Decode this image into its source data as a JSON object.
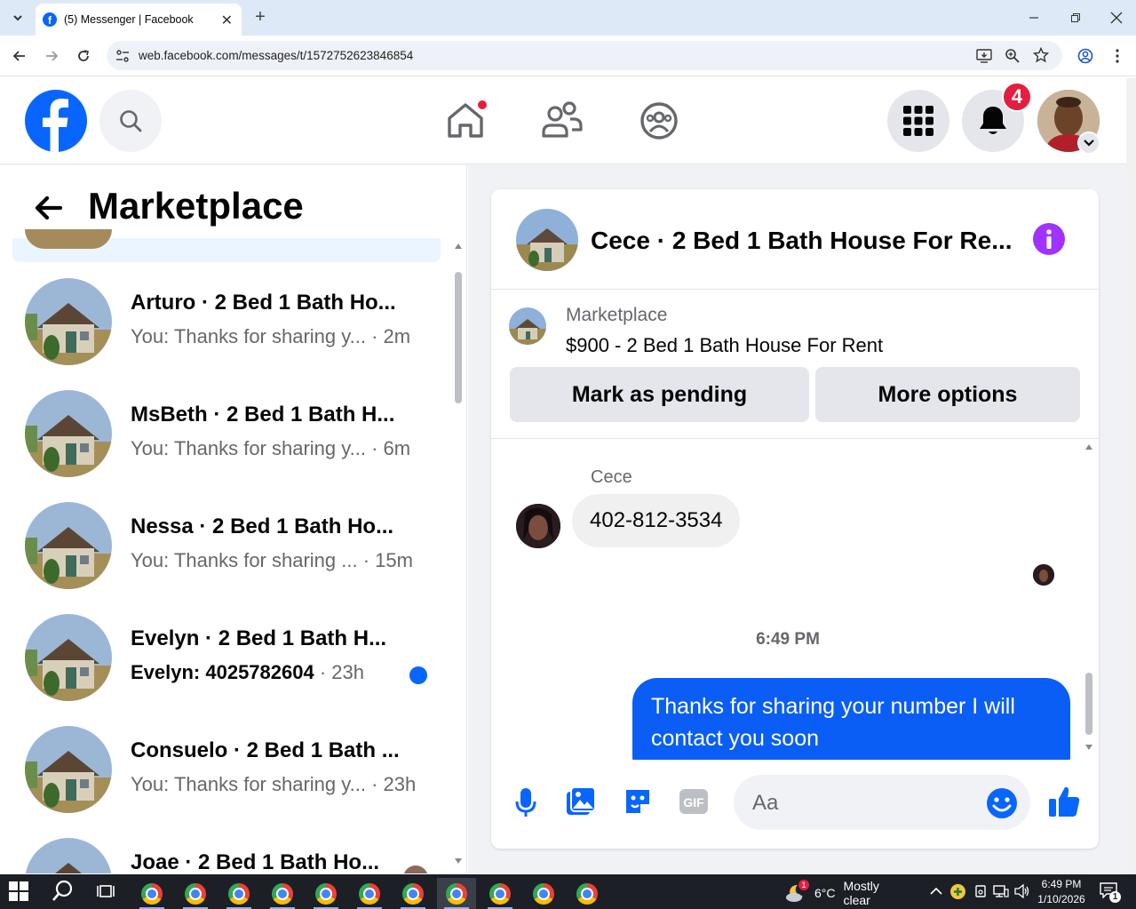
{
  "browser": {
    "tab_title": "(5) Messenger | Facebook",
    "url": "web.facebook.com/messages/t/1572752623846854"
  },
  "header": {
    "notification_count": "4"
  },
  "left_panel": {
    "title": "Marketplace",
    "conversations": [
      {
        "name": "Arturo · 2 Bed 1 Bath Ho...",
        "preview": "You: Thanks for sharing y...",
        "time": "2m",
        "unread": false
      },
      {
        "name": "MsBeth · 2 Bed 1 Bath H...",
        "preview": "You: Thanks for sharing y...",
        "time": "6m",
        "unread": false
      },
      {
        "name": "Nessa · 2 Bed 1 Bath Ho...",
        "preview": "You: Thanks for sharing ...",
        "time": "15m",
        "unread": false
      },
      {
        "name": "Evelyn · 2 Bed 1 Bath H...",
        "preview": "Evelyn: 4025782604",
        "time": "23h",
        "unread": true
      },
      {
        "name": "Consuelo · 2 Bed 1 Bath ...",
        "preview": "You: Thanks for sharing y...",
        "time": "23h",
        "unread": false
      },
      {
        "name": "Joae · 2 Bed 1 Bath Ho...",
        "preview": "",
        "time": "",
        "unread": false
      }
    ]
  },
  "chat": {
    "title": "Cece · 2 Bed 1 Bath House For Re...",
    "listing_source": "Marketplace",
    "listing_title": "$900 - 2 Bed 1 Bath House For Rent",
    "mark_pending_label": "Mark as pending",
    "more_options_label": "More options",
    "sender_name": "Cece",
    "incoming_message": "402-812-3534",
    "timestamp": "6:49 PM",
    "outgoing_message": "Thanks for sharing your number I will contact you soon",
    "composer_placeholder": "Aa"
  },
  "taskbar": {
    "weather_temp": "6°C",
    "weather_text": "Mostly clear",
    "weather_badge": "1",
    "time": "6:49 PM",
    "date": "1/10/2026",
    "notification_badge": "1"
  },
  "colors": {
    "facebook_blue": "#0866ff",
    "messenger_bubble": "#0a5ef5",
    "badge_red": "#e41e3f",
    "info_purple": "#a033ff"
  }
}
